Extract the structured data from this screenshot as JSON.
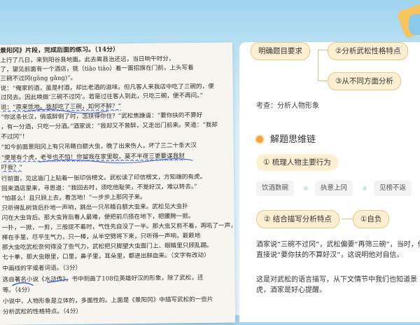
{
  "worksheet": {
    "lines": [
      "景阳冈》片段，完成后面的练习。（14分）",
      "上行了几日，来到阳谷县地面。此去离县治还远，当日晌午时分，",
      "了，望见前面有一个酒店，挑（tiāo tiǎo）着一面招旗在门前，上头写着",
      "三碗不过冈(gāng gǎng)”。",
      "说：“俺家的酒，虽是村酒，却比老酒的滋味。但凡客人来我店中吃了三碗的，便",
      "过冈去。因此唤做‘三碗不过冈’。若是过往客人到此，只吃三碗，便不再问。”",
      "说：“原来恁地。我却吃了三碗，如何不醉？”",
      "“你这条长汉，倘或醉倒了时，怎扶得你住？”武松焦躁道：“要你扶的不算好",
      "，有一分酒，只吃一分酒。”酒家说：“我却又不曾醉，又走出门前来。笑道：“我却",
      "不过冈”！",
      "“如今前面景阳冈上有只吊睛白额大虫，晚了出来伤人，坏了三二十条大汉",
      "“便是有个虎，老爷也不怕！你留我在家里歇，莫不半夜三更要谋我财",
      "吓我？”",
      "行前面，见这庙门上贴着一张印信榜文。武松读了印信榜文，方知端的有虎。",
      "回来酒店里来，寻思道：“我回去时，须吃他耻笑，不是好汉，难以转去。”",
      "“怕甚么！且只顾上去，看怎地！”一步步上那冈子来。",
      "只听得乱树背后扑地一声响，跳出一只吊睛白额大虫来。武松见大虫扑",
      "闪在大虫背后。那大虫背后看人最难，便把前爪搭在地下，把腰胯一掀。",
      "一扑，一掀，一剪，三般捉不着时，气性先自没了一半。那大虫又剪不着，再吼了一声，",
      "棒在手里，尽平生气力，只一棒，从半空劈将下来，只听得一声响，簌簌地",
      "那大虫吃武松奈何得没了些气力，武松把只脚望大虫面门上、眼睛里只顾乱踢。",
      "七十拳，那大虫眼里，口里，鼻子里，耳朵里，都迸出鲜血来。（文字有改动）",
      "中画线的字或者词语。（3分）",
      "选自著名小说《水浒传》，书中刻画了108位英雄好汉的形象，除了武松，还",
      "等。（4分）",
      "小说中，人物形象是立体的，多面性的。上面是《景阳冈》中描写武松的一些片",
      "分析武松的性格特点。（4分）"
    ]
  },
  "mindmap": {
    "root": "明确题目要求",
    "branches": [
      "②分析武松性格特点",
      "③从不同方面分析"
    ]
  },
  "exam_point": "考查：分析人物形象",
  "section_title": "解题思维链",
  "step1": "① 梳理人物主要行为",
  "actions": [
    "饮酒数碗",
    "执意上冈",
    "见榜不返"
  ],
  "step2": "② 结合描写分析特点",
  "result1": "①自负",
  "paragraph1": "酒家说“三碗不过冈”，武松偏要“再筛三碗”，当时，他直接说“要你扶的不算好汉”，这说明他对自信。",
  "paragraph2": "这是对武松的语言描写，从下文情节中我们也知道景虎，酒家是好心提醒。",
  "colors": {
    "accent": "#f0a63a",
    "node_bg": "#fdf0d2",
    "node_border": "#e7c789"
  }
}
